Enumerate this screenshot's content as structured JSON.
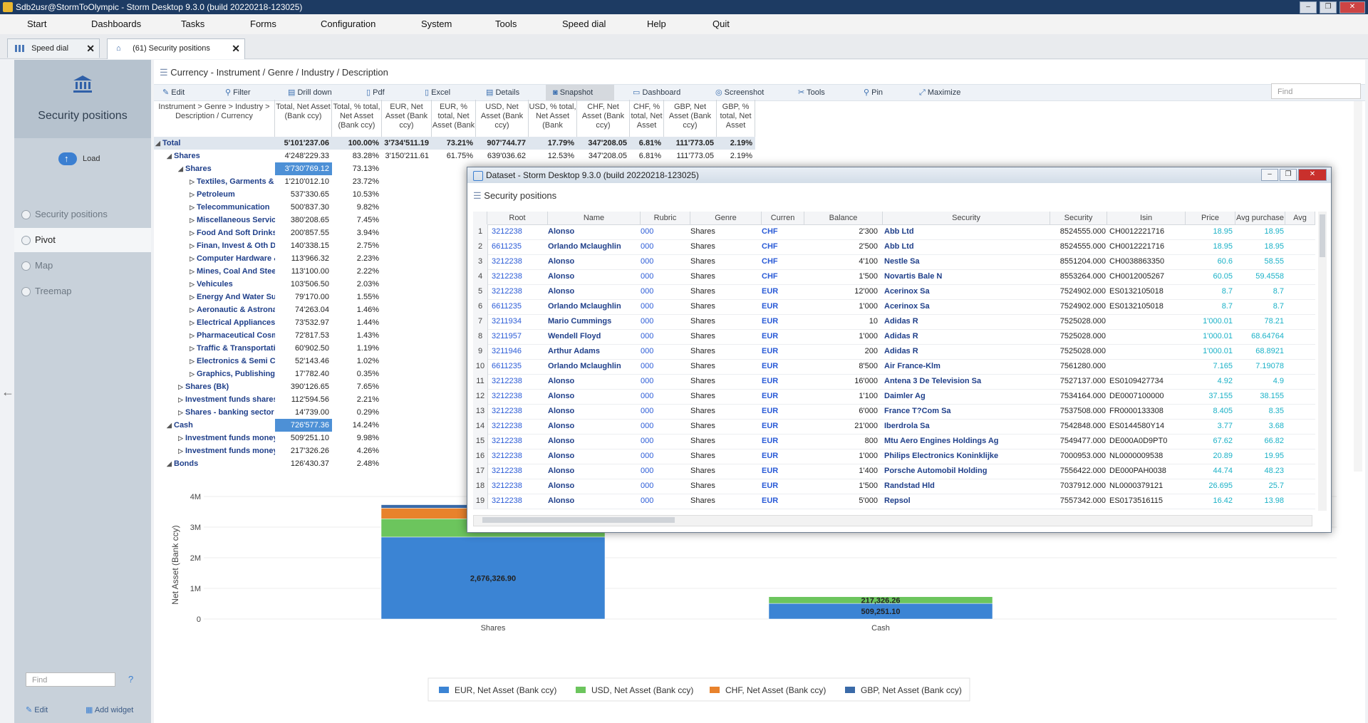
{
  "window": {
    "title": "Sdb2usr@StormToOlympic - Storm Desktop 9.3.0 (build 20220218-123025)"
  },
  "menu": [
    "Start",
    "Dashboards",
    "Tasks",
    "Forms",
    "Configuration",
    "System",
    "Tools",
    "Speed dial",
    "Help",
    "Quit"
  ],
  "tabs": [
    {
      "label": "Speed dial"
    },
    {
      "label": "(61) Security positions"
    }
  ],
  "sidebar": {
    "title": "Security positions",
    "load": "Load",
    "items": [
      "Security positions",
      "Pivot",
      "Map",
      "Treemap"
    ],
    "find_placeholder": "Find",
    "help": "?",
    "edit": "Edit",
    "add_widget": "Add widget"
  },
  "breadcrumb": "Currency - Instrument / Genre / Industry / Description",
  "toolbar": {
    "items": [
      "Edit",
      "Filter",
      "Drill down",
      "Pdf",
      "Excel",
      "Details",
      "Snapshot",
      "Dashboard",
      "Screenshot",
      "Tools",
      "Pin",
      "Maximize"
    ],
    "find_placeholder": "Find"
  },
  "pivot": {
    "headers": [
      "Instrument > Genre > Industry > Description / Currency",
      "Total, Net Asset (Bank ccy)",
      "Total, % total, Net Asset (Bank ccy)",
      "EUR, Net Asset (Bank ccy)",
      "EUR, % total, Net Asset (Bank",
      "USD, Net Asset (Bank ccy)",
      "USD, % total, Net Asset (Bank",
      "CHF, Net Asset (Bank ccy)",
      "CHF, % total, Net Asset",
      "GBP, Net Asset (Bank ccy)",
      "GBP, % total, Net Asset"
    ],
    "rows": [
      {
        "label": "Total",
        "level": 0,
        "tri": "◢",
        "values": [
          "5'101'237.06",
          "100.00%",
          "3'734'511.19",
          "73.21%",
          "907'744.77",
          "17.79%",
          "347'208.05",
          "6.81%",
          "111'773.05",
          "2.19%"
        ]
      },
      {
        "label": "Shares",
        "level": 1,
        "tri": "◢",
        "values": [
          "4'248'229.33",
          "83.28%",
          "3'150'211.61",
          "61.75%",
          "639'036.62",
          "12.53%",
          "347'208.05",
          "6.81%",
          "111'773.05",
          "2.19%"
        ]
      },
      {
        "label": "Shares",
        "level": 2,
        "tri": "◢",
        "values": [
          "3'730'769.12",
          "73.13%"
        ]
      },
      {
        "label": "Textiles, Garments & Leath...",
        "level": 3,
        "tri": "▷",
        "values": [
          "1'210'012.10",
          "23.72%"
        ]
      },
      {
        "label": "Petroleum",
        "level": 3,
        "tri": "▷",
        "values": [
          "537'330.65",
          "10.53%"
        ]
      },
      {
        "label": "Telecommunication",
        "level": 3,
        "tri": "▷",
        "values": [
          "500'837.30",
          "9.82%"
        ]
      },
      {
        "label": "Miscellaneous Services",
        "level": 3,
        "tri": "▷",
        "values": [
          "380'208.65",
          "7.45%"
        ]
      },
      {
        "label": "Food And Soft Drinks",
        "level": 3,
        "tri": "▷",
        "values": [
          "200'857.55",
          "3.94%"
        ]
      },
      {
        "label": "Finan, Invest & Oth Diversi...",
        "level": 3,
        "tri": "▷",
        "values": [
          "140'338.15",
          "2.75%"
        ]
      },
      {
        "label": "Computer Hardware & Net...",
        "level": 3,
        "tri": "▷",
        "values": [
          "113'966.32",
          "2.23%"
        ]
      },
      {
        "label": "Mines, Coal And Steel",
        "level": 3,
        "tri": "▷",
        "values": [
          "113'100.00",
          "2.22%"
        ]
      },
      {
        "label": "Vehicules",
        "level": 3,
        "tri": "▷",
        "values": [
          "103'506.50",
          "2.03%"
        ]
      },
      {
        "label": "Energy And Water Supply",
        "level": 3,
        "tri": "▷",
        "values": [
          "79'170.00",
          "1.55%"
        ]
      },
      {
        "label": "Aeronautic & Astronautic I...",
        "level": 3,
        "tri": "▷",
        "values": [
          "74'263.04",
          "1.46%"
        ]
      },
      {
        "label": "Electrical Appliances & Co...",
        "level": 3,
        "tri": "▷",
        "values": [
          "73'532.97",
          "1.44%"
        ]
      },
      {
        "label": "Pharmaceutical Cosmetics ...",
        "level": 3,
        "tri": "▷",
        "values": [
          "72'817.53",
          "1.43%"
        ]
      },
      {
        "label": "Traffic & Transportation",
        "level": 3,
        "tri": "▷",
        "values": [
          "60'902.50",
          "1.19%"
        ]
      },
      {
        "label": "Electronics & Semi Conduc...",
        "level": 3,
        "tri": "▷",
        "values": [
          "52'143.46",
          "1.02%"
        ]
      },
      {
        "label": "Graphics, Publishing & Prin...",
        "level": 3,
        "tri": "▷",
        "values": [
          "17'782.40",
          "0.35%"
        ]
      },
      {
        "label": "Shares (Bk)",
        "level": 2,
        "tri": "▷",
        "values": [
          "390'126.65",
          "7.65%"
        ]
      },
      {
        "label": "Investment funds shares",
        "level": 2,
        "tri": "▷",
        "values": [
          "112'594.56",
          "2.21%"
        ]
      },
      {
        "label": "Shares - banking sector",
        "level": 2,
        "tri": "▷",
        "values": [
          "14'739.00",
          "0.29%"
        ]
      },
      {
        "label": "Cash",
        "level": 1,
        "tri": "◢",
        "values": [
          "726'577.36",
          "14.24%"
        ]
      },
      {
        "label": "Investment funds money mark...",
        "level": 2,
        "tri": "▷",
        "values": [
          "509'251.10",
          "9.98%"
        ]
      },
      {
        "label": "Investment funds money market",
        "level": 2,
        "tri": "▷",
        "values": [
          "217'326.26",
          "4.26%"
        ]
      },
      {
        "label": "Bonds",
        "level": 1,
        "tri": "◢",
        "values": [
          "126'430.37",
          "2.48%"
        ]
      }
    ]
  },
  "chart_data": {
    "type": "bar",
    "stacked": true,
    "categories": [
      "Shares",
      "Cash"
    ],
    "series": [
      {
        "name": "EUR, Net Asset (Bank ccy)",
        "color": "#3b84d4",
        "values": [
          2676326.9,
          509251.1
        ],
        "labels": [
          "2,676,326.90",
          "509,251.10"
        ]
      },
      {
        "name": "USD, Net Asset (Bank ccy)",
        "color": "#6cc55d",
        "values": [
          595461.12,
          217326.26
        ],
        "labels": [
          "595,461.12",
          "217,326.26"
        ]
      },
      {
        "name": "CHF, Net Asset (Bank ccy)",
        "color": "#e8822c",
        "values": [
          347208.05,
          0
        ],
        "labels": [
          "",
          ""
        ]
      },
      {
        "name": "GBP, Net Asset (Bank ccy)",
        "color": "#3a6aa8",
        "values": [
          111773.05,
          0
        ],
        "labels": [
          "",
          ""
        ]
      }
    ],
    "ylabel": "Net Asset (Bank ccy)",
    "yticks": [
      "0",
      "1M",
      "2M",
      "3M",
      "4M"
    ],
    "ylim": [
      0,
      4000000
    ],
    "legend": "bottom"
  },
  "dialog": {
    "title": "Dataset -  Storm Desktop 9.3.0 (build 20220218-123025)",
    "subtitle": "Security positions",
    "columns": [
      "Root",
      "Name",
      "Rubric",
      "Genre",
      "Curren",
      "Balance",
      "Security",
      "Security",
      "Isin",
      "Price",
      "Avg purchase",
      "Avg"
    ],
    "rows": [
      [
        "1",
        "3212238",
        "Alonso",
        "000",
        "Shares",
        "CHF",
        "2'300",
        "Abb Ltd",
        "8524555.000",
        "CH0012221716",
        "18.95",
        "18.95"
      ],
      [
        "2",
        "6611235",
        "Orlando Mclaughlin",
        "000",
        "Shares",
        "CHF",
        "2'500",
        "Abb Ltd",
        "8524555.000",
        "CH0012221716",
        "18.95",
        "18.95"
      ],
      [
        "3",
        "3212238",
        "Alonso",
        "000",
        "Shares",
        "CHF",
        "4'100",
        "Nestle Sa",
        "8551204.000",
        "CH0038863350",
        "60.6",
        "58.55"
      ],
      [
        "4",
        "3212238",
        "Alonso",
        "000",
        "Shares",
        "CHF",
        "1'500",
        "Novartis Bale N",
        "8553264.000",
        "CH0012005267",
        "60.05",
        "59.4558"
      ],
      [
        "5",
        "3212238",
        "Alonso",
        "000",
        "Shares",
        "EUR",
        "12'000",
        "Acerinox Sa",
        "7524902.000",
        "ES0132105018",
        "8.7",
        "8.7"
      ],
      [
        "6",
        "6611235",
        "Orlando Mclaughlin",
        "000",
        "Shares",
        "EUR",
        "1'000",
        "Acerinox Sa",
        "7524902.000",
        "ES0132105018",
        "8.7",
        "8.7"
      ],
      [
        "7",
        "3211934",
        "Mario Cummings",
        "000",
        "Shares",
        "EUR",
        "10",
        "Adidas R",
        "7525028.000",
        "",
        "1'000.01",
        "78.21"
      ],
      [
        "8",
        "3211957",
        "Wendell Floyd",
        "000",
        "Shares",
        "EUR",
        "1'000",
        "Adidas R",
        "7525028.000",
        "",
        "1'000.01",
        "68.64764"
      ],
      [
        "9",
        "3211946",
        "Arthur Adams",
        "000",
        "Shares",
        "EUR",
        "200",
        "Adidas R",
        "7525028.000",
        "",
        "1'000.01",
        "68.8921"
      ],
      [
        "10",
        "6611235",
        "Orlando Mclaughlin",
        "000",
        "Shares",
        "EUR",
        "8'500",
        "Air France-Klm",
        "7561280.000",
        "",
        "7.165",
        "7.19078"
      ],
      [
        "11",
        "3212238",
        "Alonso",
        "000",
        "Shares",
        "EUR",
        "16'000",
        "Antena 3 De Television Sa",
        "7527137.000",
        "ES0109427734",
        "4.92",
        "4.9"
      ],
      [
        "12",
        "3212238",
        "Alonso",
        "000",
        "Shares",
        "EUR",
        "1'100",
        "Daimler Ag",
        "7534164.000",
        "DE0007100000",
        "37.155",
        "38.155"
      ],
      [
        "13",
        "3212238",
        "Alonso",
        "000",
        "Shares",
        "EUR",
        "6'000",
        "France T?Com Sa",
        "7537508.000",
        "FR0000133308",
        "8.405",
        "8.35"
      ],
      [
        "14",
        "3212238",
        "Alonso",
        "000",
        "Shares",
        "EUR",
        "21'000",
        "Iberdrola Sa",
        "7542848.000",
        "ES0144580Y14",
        "3.77",
        "3.68"
      ],
      [
        "15",
        "3212238",
        "Alonso",
        "000",
        "Shares",
        "EUR",
        "800",
        "Mtu Aero Engines Holdings Ag",
        "7549477.000",
        "DE000A0D9PT0",
        "67.62",
        "66.82"
      ],
      [
        "16",
        "3212238",
        "Alonso",
        "000",
        "Shares",
        "EUR",
        "1'000",
        "Philips Electronics Koninklijke",
        "7000953.000",
        "NL0000009538",
        "20.89",
        "19.95"
      ],
      [
        "17",
        "3212238",
        "Alonso",
        "000",
        "Shares",
        "EUR",
        "1'400",
        "Porsche Automobil Holding",
        "7556422.000",
        "DE000PAH0038",
        "44.74",
        "48.23"
      ],
      [
        "18",
        "3212238",
        "Alonso",
        "000",
        "Shares",
        "EUR",
        "1'500",
        "Randstad Hld",
        "7037912.000",
        "NL0000379121",
        "26.695",
        "25.7"
      ],
      [
        "19",
        "3212238",
        "Alonso",
        "000",
        "Shares",
        "EUR",
        "5'000",
        "Repsol",
        "7557342.000",
        "ES0173516115",
        "16.42",
        "13.98"
      ]
    ]
  }
}
